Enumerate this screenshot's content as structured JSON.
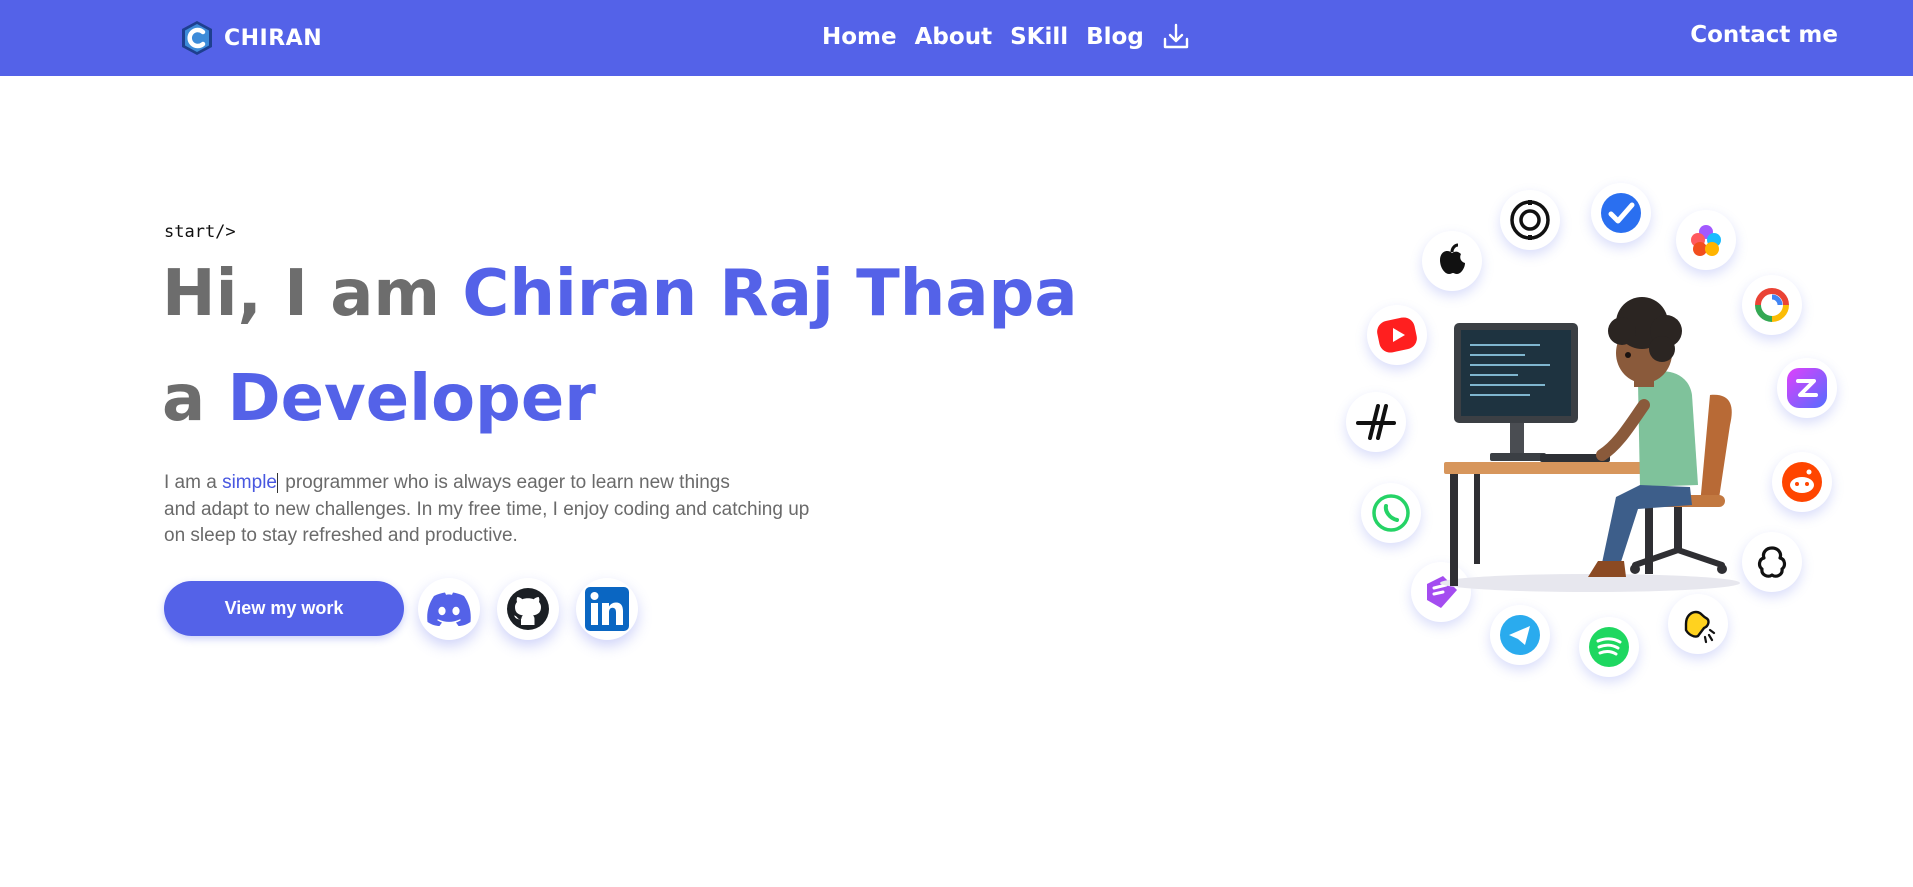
{
  "nav": {
    "brand": "CHIRAN",
    "links": [
      "Home",
      "About",
      "SKill",
      "Blog"
    ],
    "download_icon": "download-icon",
    "contact": "Contact me"
  },
  "hero": {
    "tag": "start/>",
    "greeting": "Hi, I am ",
    "name": "Chiran Raj Thapa",
    "role_prefix": "a ",
    "role": "Developer",
    "desc_before": "I am a ",
    "desc_highlight": "simple",
    "desc_line1_after": " programmer who is always eager to learn new things",
    "desc_line2": "and adapt to new challenges. In my free time, I enjoy coding and catching up",
    "desc_line3": "on sleep to stay refreshed and productive.",
    "cta": "View my work"
  },
  "social_icons": [
    "discord-icon",
    "github-icon",
    "linkedin-icon"
  ],
  "colors": {
    "primary": "#5462e8",
    "heading_gray": "#6d6d6d",
    "text_gray": "#6a6a6a"
  }
}
